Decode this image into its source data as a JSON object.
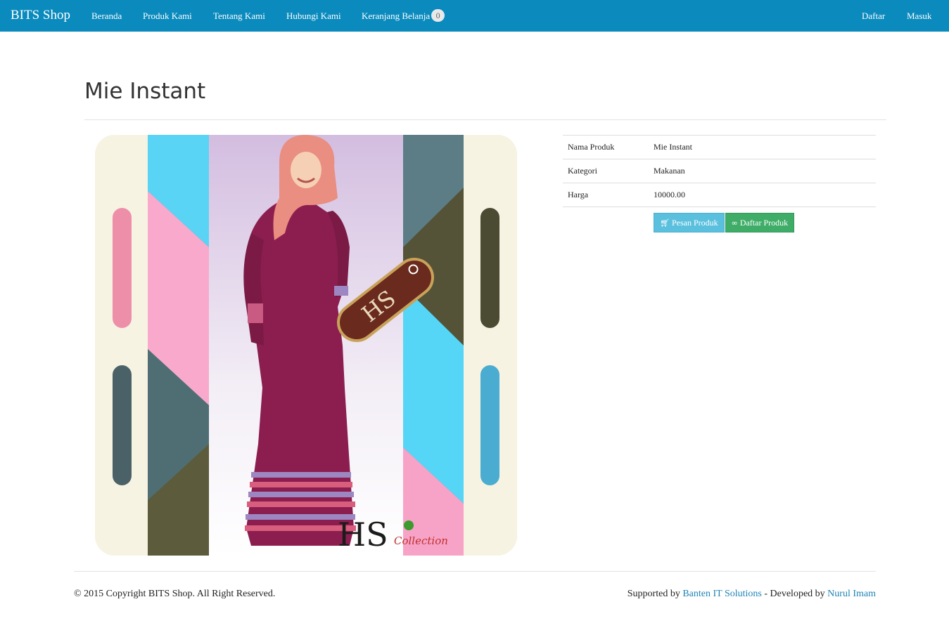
{
  "navbar": {
    "brand": "BITS Shop",
    "links": [
      "Beranda",
      "Produk Kami",
      "Tentang Kami",
      "Hubungi Kami",
      "Keranjang Belanja"
    ],
    "cart_count": "0",
    "right_links": [
      "Daftar",
      "Masuk"
    ],
    "color": "#0a8abd"
  },
  "page": {
    "title": "Mie Instant"
  },
  "product": {
    "image_logo": "HS",
    "image_logo_sub": "Collection",
    "details": [
      {
        "label": "Nama Produk",
        "value": "Mie Instant"
      },
      {
        "label": "Kategori",
        "value": "Makanan"
      },
      {
        "label": "Harga",
        "value": "10000.00"
      }
    ],
    "buttons": {
      "order_label": "Pesan Produk",
      "order_icon": "cart-icon",
      "list_label": "Daftar Produk",
      "list_icon": "link-icon"
    }
  },
  "footer": {
    "copyright": "© 2015 Copyright BITS Shop. All Right Reserved.",
    "supported_prefix": "Supported by",
    "supporter": "Banten IT Solutions",
    "developed_prefix": "- Developed by",
    "developer": "Nurul Imam"
  }
}
